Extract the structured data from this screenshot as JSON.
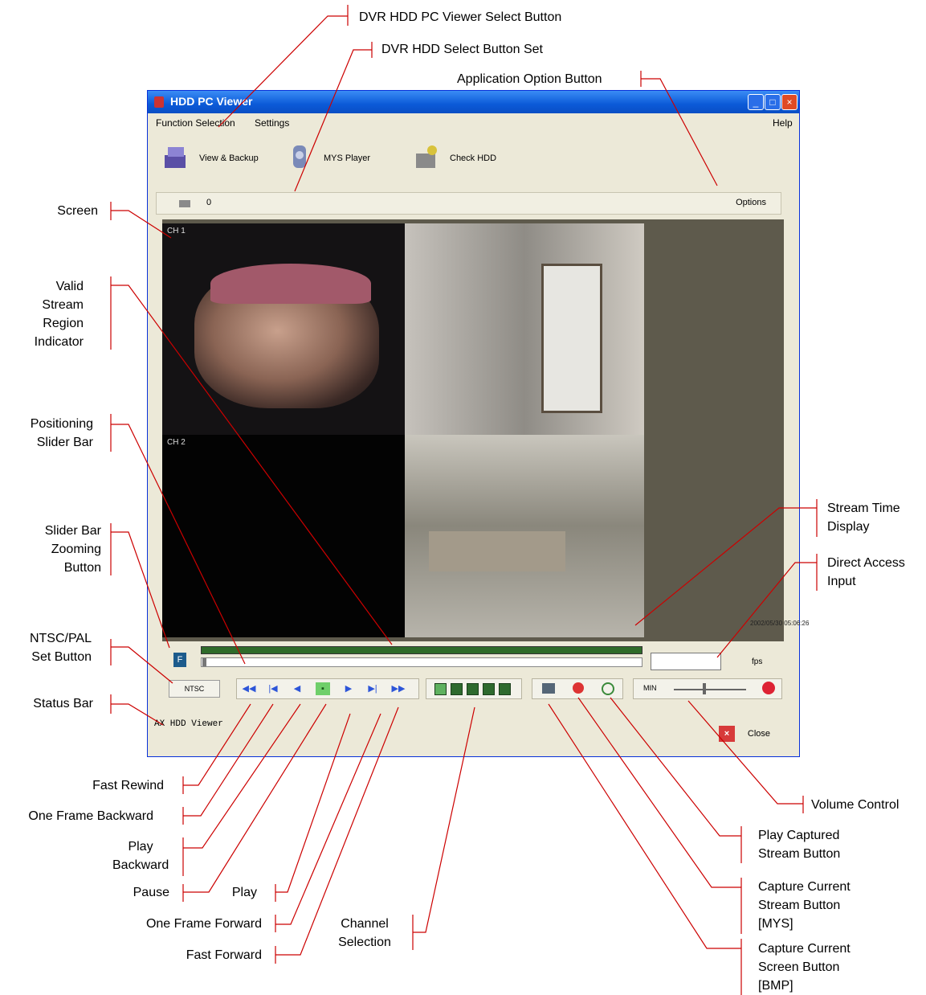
{
  "window": {
    "title": "HDD PC Viewer",
    "menu": [
      "Function Selection",
      "Settings",
      "Help"
    ],
    "tools": [
      {
        "label": "View & Backup",
        "icon": "view-backup-icon"
      },
      {
        "label": "MYS Player",
        "icon": "mys-player-icon"
      },
      {
        "label": "Check HDD",
        "icon": "check-hdd-icon"
      }
    ],
    "hdd_number": "0",
    "options_label": "Options",
    "cam_labels": [
      "CH 1",
      "CH 2"
    ],
    "stream_time": "2002/05/30 05:06:26",
    "fps_label": "fps",
    "ntsc_label": "NTSC",
    "volume_label": "MIN",
    "status_text": "AX HDD Viewer",
    "close_label": "Close"
  },
  "annotations": {
    "pc_viewer_select": "DVR HDD PC Viewer Select Button",
    "hdd_select": "DVR HDD Select Button Set",
    "app_option": "Application Option Button",
    "screen": "Screen",
    "valid_stream": [
      "Valid",
      "Stream",
      "Region",
      "Indicator"
    ],
    "positioning": [
      "Positioning",
      "Slider Bar"
    ],
    "zoom": [
      "Slider Bar",
      "Zooming",
      "Button"
    ],
    "ntsc": [
      "NTSC/PAL",
      "Set Button"
    ],
    "status": "Status Bar",
    "stream_time": [
      "Stream Time",
      "Display"
    ],
    "direct_access": [
      "Direct Access",
      "Input"
    ],
    "fast_rewind": "Fast Rewind",
    "one_frame_back": "One Frame Backward",
    "play_back": [
      "Play",
      "Backward"
    ],
    "pause": "Pause",
    "play": "Play",
    "one_frame_fwd": "One Frame Forward",
    "fast_fwd": "Fast Forward",
    "channel": [
      "Channel",
      "Selection"
    ],
    "volume": "Volume Control",
    "play_captured": [
      "Play Captured",
      "Stream Button"
    ],
    "capture_stream": [
      "Capture Current",
      "Stream Button",
      "[MYS]"
    ],
    "capture_screen": [
      "Capture Current",
      "Screen Button",
      "[BMP]"
    ]
  },
  "colors": {
    "leader": "#cc0000",
    "titlebar": "#0b5ad8"
  }
}
